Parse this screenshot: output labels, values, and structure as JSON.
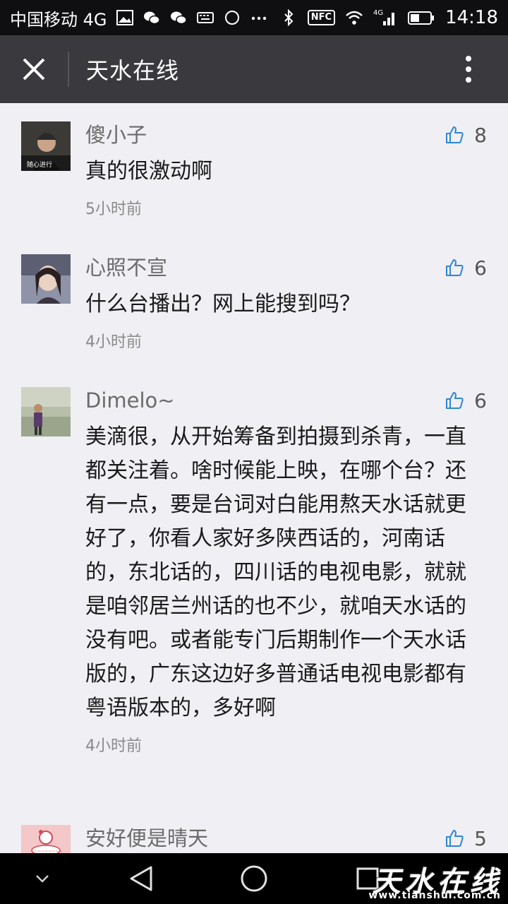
{
  "status_bar": {
    "carrier": "中国移动 4G",
    "nfc": "NFC",
    "network": "4G",
    "time": "14:18"
  },
  "header": {
    "title": "天水在线",
    "close_icon": "close-icon",
    "more_icon": "more-vertical-icon"
  },
  "comments": [
    {
      "name": "傻小子",
      "text": "真的很激动啊",
      "time": "5小时前",
      "likes": "8",
      "avatar": "avatar-man-cap"
    },
    {
      "name": "心照不宣",
      "text": "什么台播出？网上能搜到吗？",
      "time": "4小时前",
      "likes": "6",
      "avatar": "avatar-woman"
    },
    {
      "name": "Dimelo~",
      "text": "美滴很，从开始筹备到拍摄到杀青，一直都关注着。啥时候能上映，在哪个台？还有一点，要是台词对白能用熬天水话就更好了，你看人家好多陕西话的，河南话的，东北话的，四川话的电视电影，就就是咱邻居兰州话的也不少，就咱天水话的没有吧。或者能专门后期制作一个天水话版的，广东这边好多普通话电视电影都有粤语版本的，多好啊",
      "time": "4小时前",
      "likes": "6",
      "avatar": "avatar-landscape"
    },
    {
      "name": "安好便是晴天",
      "text": "",
      "time": "",
      "likes": "5",
      "avatar": "avatar-cartoon"
    }
  ],
  "nav": {
    "back_icon": "back-triangle-icon",
    "home_icon": "home-circle-icon",
    "recent_icon": "recent-square-icon",
    "down_icon": "chevron-down-icon"
  },
  "watermark": {
    "text": "天水在线",
    "url": "www.tianshui.com.cn"
  }
}
